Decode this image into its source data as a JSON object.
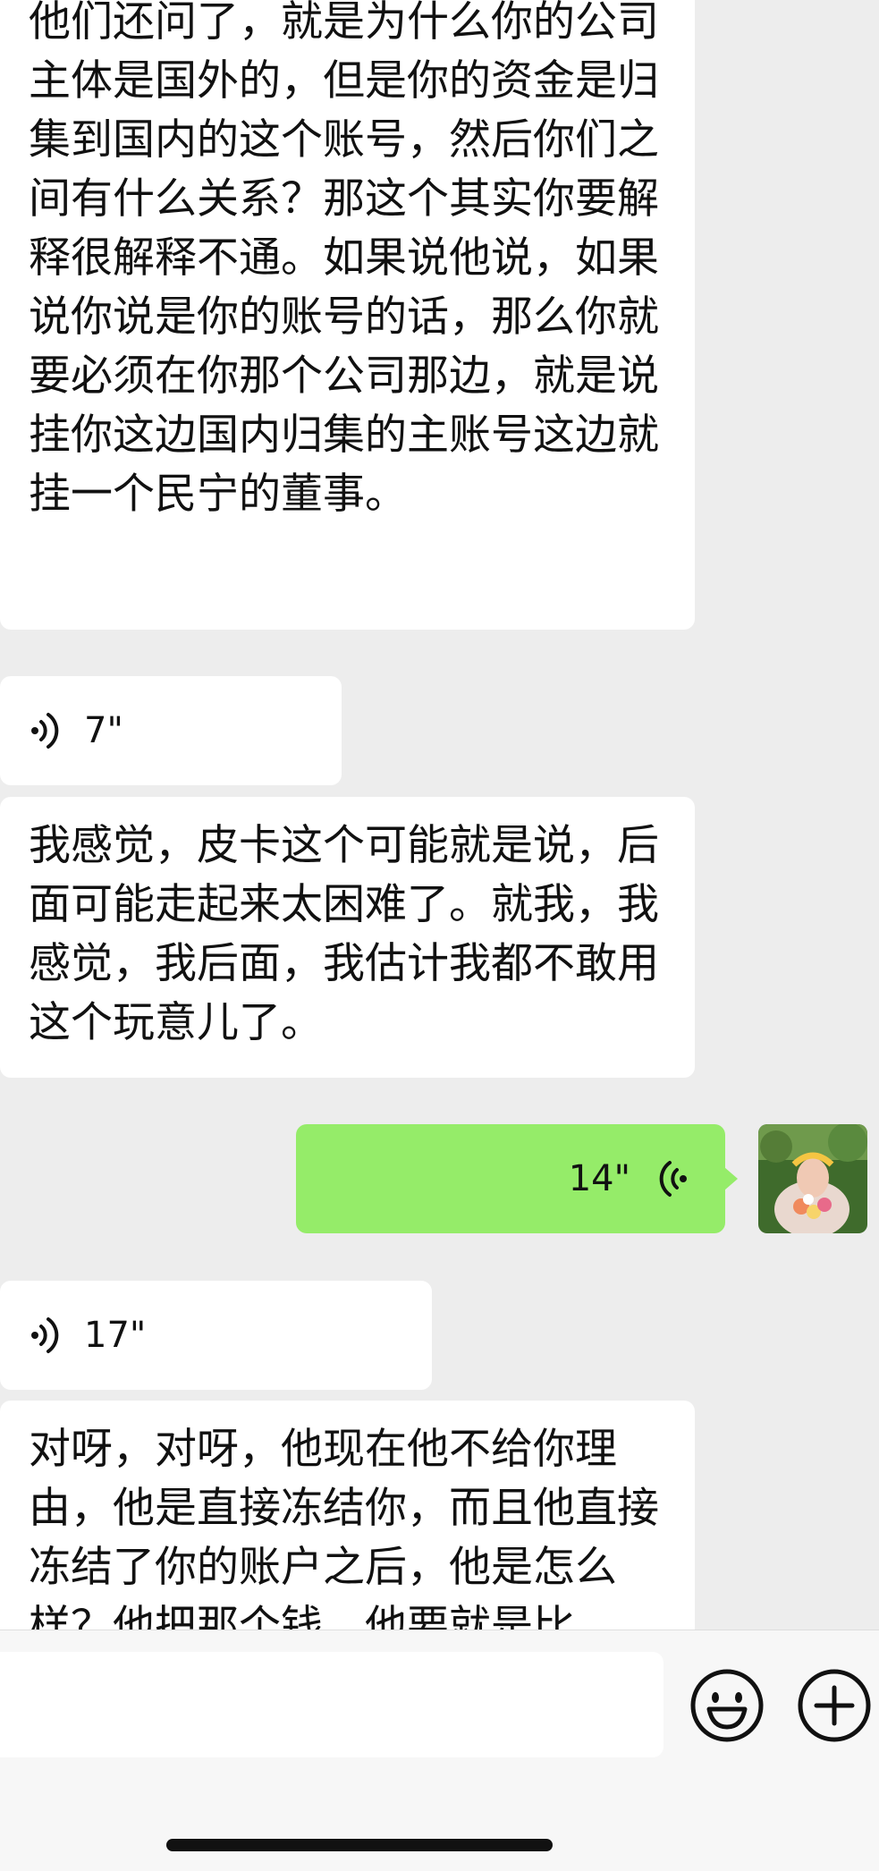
{
  "messages": [
    {
      "type": "text",
      "direction": "in",
      "text": "他们还问了，就是为什么你的公司主体是国外的，但是你的资金是归集到国内的这个账号，然后你们之间有什么关系？那这个其实你要解释很解释不通。如果说他说，如果说你说是你的账号的话，那么你就要必须在你那个公司那边，就是说挂你这边国内归集的主账号这边就挂一个民宁的董事。"
    },
    {
      "type": "voice",
      "direction": "in",
      "duration": "7\""
    },
    {
      "type": "text",
      "direction": "in",
      "text": "我感觉，皮卡这个可能就是说，后面可能走起来太困难了。就我，我感觉，我后面，我估计我都不敢用这个玩意儿了。"
    },
    {
      "type": "voice",
      "direction": "out",
      "duration": "14\""
    },
    {
      "type": "voice",
      "direction": "in",
      "duration": "17\""
    },
    {
      "type": "text",
      "direction": "in",
      "text": "对呀，对呀，他现在他不给你理由，他是直接冻结你，而且他直接冻结了你的账户之后，他是怎么样？他把那个钱，他要就是比"
    }
  ],
  "input_bar": {
    "emoji_icon": "emoji-smile-icon",
    "more_icon": "plus-circle-icon"
  },
  "colors": {
    "background": "#ededed",
    "bubble_in": "#ffffff",
    "bubble_out": "#95ec69",
    "text": "#111111"
  }
}
